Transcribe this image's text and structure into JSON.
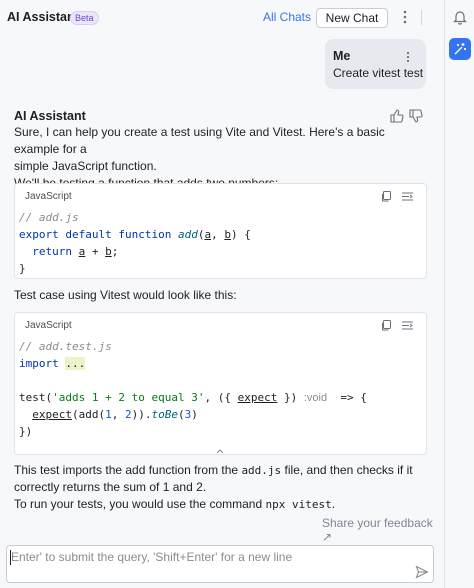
{
  "header": {
    "title": "AI Assistant",
    "badge": "Beta",
    "all_chats": "All Chats",
    "new_chat": "New Chat"
  },
  "user_message": {
    "author": "Me",
    "text": "Create vitest test"
  },
  "assistant": {
    "author": "AI Assistant",
    "intro_line1": "Sure, I can help you create a test using Vite and Vitest. Here's a basic example for a",
    "intro_line2": "simple JavaScript function.",
    "intro_line3": "We'll be testing a function that adds two numbers:",
    "mid_text": "Test case using Vitest would look like this:",
    "outro_1a": "This test imports the add function from the ",
    "outro_1code": "add.js",
    "outro_1b": " file, and then checks if it",
    "outro_2": "correctly returns the sum of 1 and 2.",
    "outro_3a": "To run your tests, you would use the command ",
    "outro_3code": "npx vitest",
    "outro_3b": ".",
    "share_feedback": "Share your feedback ↗"
  },
  "code_block_1": {
    "language": "JavaScript",
    "line1": "// add.js",
    "line2_kw1": "export",
    "line2_kw2": "default",
    "line2_kw3": "function",
    "line2_fn": "add",
    "line2_p1": "a",
    "line2_p2": "b",
    "line3_kw": "return",
    "line3_a": "a",
    "line3_b": "b",
    "line4": "}"
  },
  "code_block_2": {
    "language": "JavaScript",
    "line1": "// add.test.js",
    "line2_kw": "import",
    "line2_dots": "...",
    "line4_fn": "test(",
    "line4_str": "'adds 1 + 2 to equal 3'",
    "line4_param": "expect",
    "line4_hint": ":void",
    "line5_fn": "expect",
    "line5_call": "(add(",
    "line5_n1": "1",
    "line5_n2": "2",
    "line5_tobe": "toBe",
    "line5_n3": "3",
    "line6": "})"
  },
  "input": {
    "placeholder": "Enter' to submit the query, 'Shift+Enter' for a new line"
  },
  "icons": [
    "kebab-icon",
    "bell-icon",
    "ai-sparkle-icon",
    "thumbs-up-icon",
    "thumbs-down-icon",
    "copy-icon",
    "insert-icon",
    "chevron-up-icon",
    "send-icon"
  ],
  "colors": {
    "accent": "#3574f0",
    "keyword": "#0033b3",
    "string": "#067d17",
    "number": "#1750eb"
  }
}
